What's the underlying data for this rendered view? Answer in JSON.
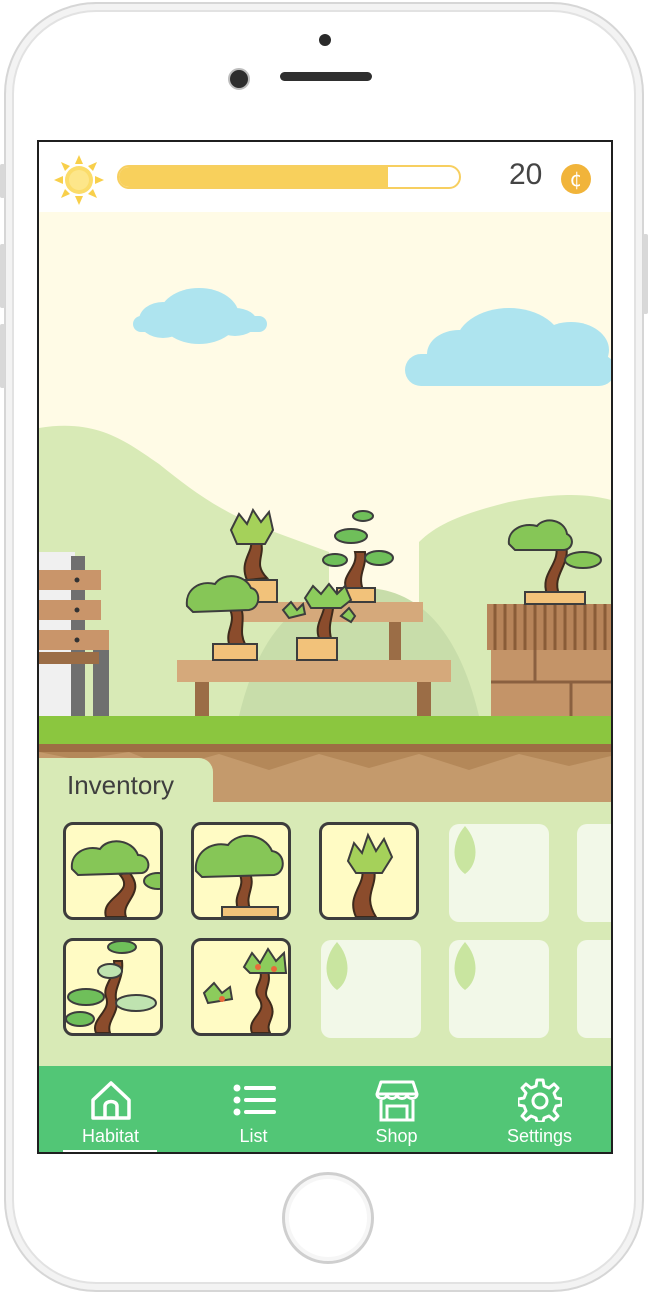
{
  "status": {
    "sun_icon": "sun-icon",
    "progress": 0.79,
    "coins": "20",
    "coin_symbol": "¢"
  },
  "inventory": {
    "title": "Inventory",
    "slots": [
      {
        "kind": "bonsai-cloud"
      },
      {
        "kind": "bonsai-round"
      },
      {
        "kind": "bonsai-twist"
      },
      {
        "kind": "empty"
      },
      {
        "kind": "empty"
      },
      {
        "kind": "bonsai-pine"
      },
      {
        "kind": "bonsai-fruit"
      },
      {
        "kind": "empty"
      },
      {
        "kind": "empty"
      },
      {
        "kind": "empty"
      }
    ]
  },
  "nav": {
    "items": [
      {
        "label": "Habitat",
        "icon": "home-icon"
      },
      {
        "label": "List",
        "icon": "list-icon"
      },
      {
        "label": "Shop",
        "icon": "shop-icon"
      },
      {
        "label": "Settings",
        "icon": "gear-icon"
      }
    ],
    "active": "Habitat"
  },
  "colors": {
    "accent": "#52c676",
    "progress": "#f8d05c",
    "coin": "#f1b43a",
    "sky": "#fffbe6",
    "grass": "#8bc63f",
    "soil": "#b48859",
    "inventory_bg": "#d8eab6"
  }
}
